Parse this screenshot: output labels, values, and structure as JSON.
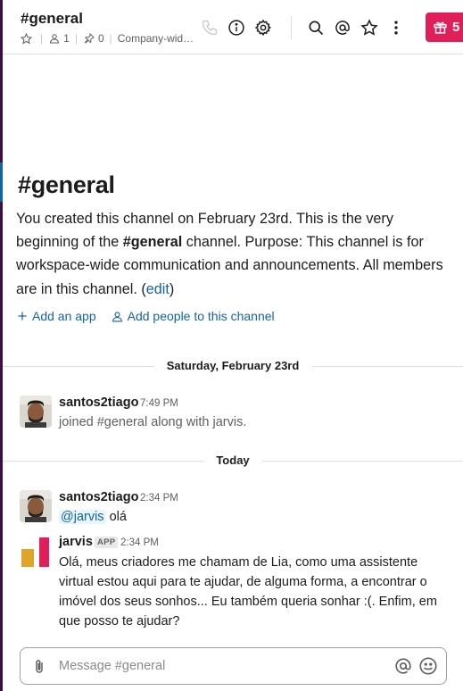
{
  "header": {
    "channel_title": "#general",
    "member_count": "1",
    "pinned_count": "0",
    "topic": "Company-wid…",
    "gift_count": "5"
  },
  "intro": {
    "title_hash": "#",
    "title": "general",
    "text_before": "You created this channel on February 23rd. This is the very beginning of the ",
    "channel_bold": "#general",
    "text_after": " channel. Purpose: This channel is for workspace-wide communication and announcements. All members are in this channel. (",
    "edit_link": "edit",
    "text_end": ")",
    "add_app": "Add an app",
    "add_people": "Add people to this channel"
  },
  "dividers": {
    "first": "Saturday, February 23rd",
    "second": "Today"
  },
  "messages": [
    {
      "author": "santos2tiago",
      "time": "7:49 PM",
      "text": "joined #general along with jarvis."
    },
    {
      "author": "santos2tiago",
      "time": "2:34 PM",
      "mention": "@jarvis",
      "text": " olá"
    },
    {
      "author": "jarvis",
      "badge": "APP",
      "time": "2:34 PM",
      "text": "Olá, meus criadores me chamam de Lia, como uma assistente virtual estou aqui para te ajudar, de alguma forma, a encontrar o imóvel dos seus sonhos... Eu também queria sonhar :(. Enfim, em que posso te ajudar?"
    }
  ],
  "composer": {
    "placeholder": "Message #general"
  },
  "colors": {
    "accent_link": "#1264a3",
    "gift_red": "#e01e5a",
    "sidebar_purple": "#3f0e40"
  },
  "icons": {
    "header": [
      "star-icon",
      "person-icon",
      "pin-icon",
      "phone-icon",
      "info-icon",
      "gear-icon",
      "search-icon",
      "at-icon",
      "star-icon",
      "more-vertical-icon",
      "gift-icon"
    ],
    "composer": [
      "paperclip-icon",
      "at-icon",
      "emoji-icon"
    ]
  }
}
